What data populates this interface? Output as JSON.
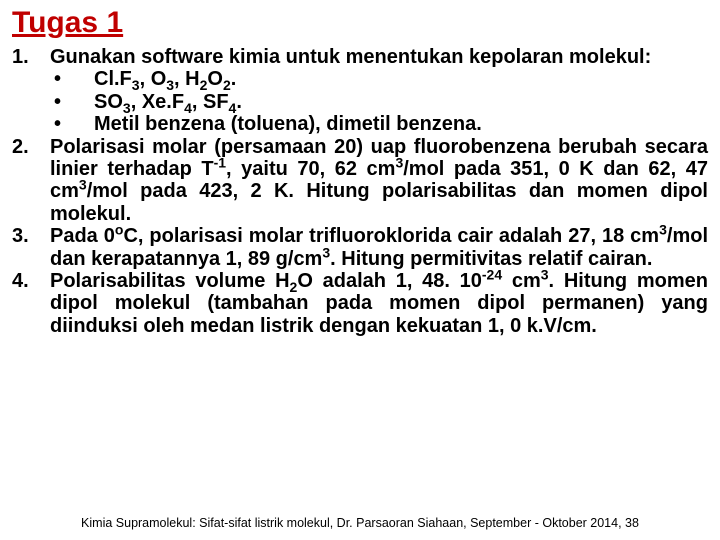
{
  "title": "Tugas 1",
  "items": [
    {
      "num": "1.",
      "lead": "Gunakan software kimia untuk menentukan kepolaran molekul:",
      "sub": [
        "Cl. F₃, O₃, H₂O₂.",
        "SO₃, Xe. F₄, SF₄.",
        "Metil benzena (toluena), dimetil benzena."
      ]
    },
    {
      "num": "2.",
      "text": "Polarisasi molar (persamaan 20) uap fluorobenzena berubah secara linier terhadap T⁻¹, yaitu 70, 62 cm³/mol pada 351, 0 K dan 62, 47 cm³/mol pada 423, 2 K. Hitung polarisabilitas dan momen dipol molekul."
    },
    {
      "num": "3.",
      "text": "Pada 0ᵒC, polarisasi molar trifluoroklorida cair adalah 27, 18 cm³/mol dan kerapatannya 1, 89 g/cm³. Hitung permitivitas relatif cairan."
    },
    {
      "num": "4.",
      "text": "Polarisabilitas volume H₂O adalah 1, 48. 10⁻²⁴ cm³. Hitung momen dipol molekul (tambahan pada momen dipol permanen) yang diinduksi oleh medan listrik dengan kekuatan 1, 0 k. V/cm."
    }
  ],
  "footer": "Kimia Supramolekul: Sifat-sifat listrik molekul, Dr. Parsaoran Siahaan, September - Oktober 2014, 38"
}
